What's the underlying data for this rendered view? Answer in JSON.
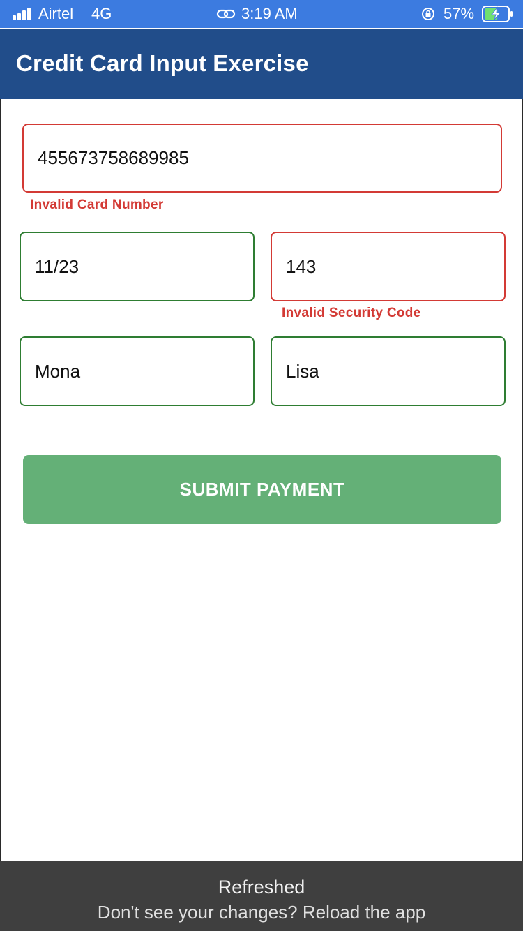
{
  "status_bar": {
    "carrier": "Airtel",
    "network": "4G",
    "time": "3:19 AM",
    "battery": "57%",
    "battery_level": 0.57,
    "icons": [
      "signal-icon",
      "link-icon",
      "orientation-lock-icon",
      "battery-charging-icon"
    ]
  },
  "header": {
    "title": "Credit Card Input Exercise"
  },
  "form": {
    "card_number": {
      "value": "455673758689985",
      "error": "Invalid Card Number"
    },
    "expiry": {
      "value": "11/23"
    },
    "security_code": {
      "value": "143",
      "error": "Invalid Security Code"
    },
    "first_name": {
      "value": "Mona"
    },
    "last_name": {
      "value": "Lisa"
    },
    "submit_label": "SUBMIT PAYMENT"
  },
  "toast": {
    "title": "Refreshed",
    "message": "Don't see your changes? Reload the app"
  },
  "colors": {
    "status_bar": "#3c7be0",
    "header": "#214d8a",
    "valid_border": "#2e7d32",
    "invalid_border": "#d33a35",
    "submit_button": "#64b077",
    "toast": "#3f3f3f"
  }
}
